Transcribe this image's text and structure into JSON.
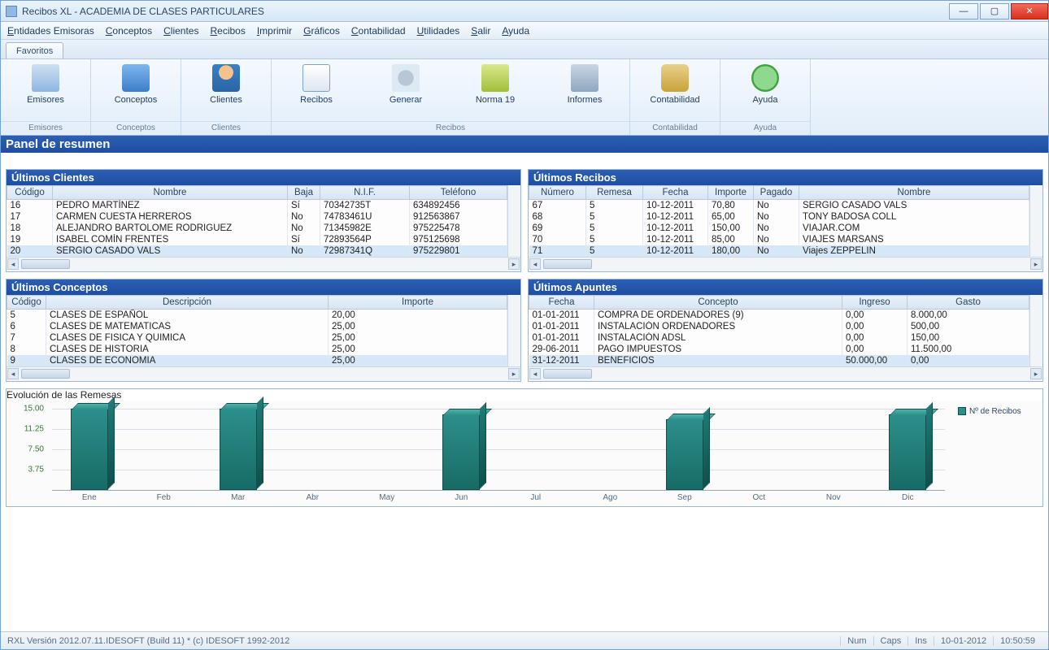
{
  "window": {
    "title": "Recibos XL - ACADEMIA DE CLASES PARTICULARES"
  },
  "menu": [
    "Entidades Emisoras",
    "Conceptos",
    "Clientes",
    "Recibos",
    "Imprimir",
    "Gráficos",
    "Contabilidad",
    "Utilidades",
    "Salir",
    "Ayuda"
  ],
  "ribbon": {
    "tab": "Favoritos",
    "groups": [
      {
        "caption": "Emisores",
        "items": [
          {
            "label": "Emisores",
            "icon": "building"
          }
        ]
      },
      {
        "caption": "Conceptos",
        "items": [
          {
            "label": "Conceptos",
            "icon": "box"
          }
        ]
      },
      {
        "caption": "Clientes",
        "items": [
          {
            "label": "Clientes",
            "icon": "person"
          }
        ]
      },
      {
        "caption": "Recibos",
        "items": [
          {
            "label": "Recibos",
            "icon": "edit"
          },
          {
            "label": "Generar",
            "icon": "gears"
          },
          {
            "label": "Norma 19",
            "icon": "money"
          },
          {
            "label": "Informes",
            "icon": "printer"
          }
        ]
      },
      {
        "caption": "Contabilidad",
        "items": [
          {
            "label": "Contabilidad",
            "icon": "bag"
          }
        ]
      },
      {
        "caption": "Ayuda",
        "items": [
          {
            "label": "Ayuda",
            "icon": "help"
          }
        ]
      }
    ]
  },
  "summary_title": "Panel de resumen",
  "panel_clientes": {
    "title": "Últimos Clientes",
    "cols": [
      "Código",
      "Nombre",
      "Baja",
      "N.I.F.",
      "Teléfono"
    ],
    "rows": [
      [
        "16",
        "PEDRO MARTÍNEZ",
        "Sí",
        "70342735T",
        "634892456"
      ],
      [
        "17",
        "CARMEN CUESTA HERREROS",
        "No",
        "74783461U",
        "912563867"
      ],
      [
        "18",
        "ALEJANDRO BARTOLOME RODRIGUEZ",
        "No",
        "71345982E",
        "975225478"
      ],
      [
        "19",
        "ISABEL COMÍN FRENTES",
        "Sí",
        "72893564P",
        "975125698"
      ],
      [
        "20",
        "SERGIO CASADO VALS",
        "No",
        "72987341Q",
        "975229801"
      ]
    ],
    "selected_index": 4
  },
  "panel_recibos": {
    "title": "Últimos Recibos",
    "cols": [
      "Número",
      "Remesa",
      "Fecha",
      "Importe",
      "Pagado",
      "Nombre"
    ],
    "rows": [
      [
        "67",
        "5",
        "10-12-2011",
        "70,80",
        "No",
        "SERGIO CASADO VALS"
      ],
      [
        "68",
        "5",
        "10-12-2011",
        "65,00",
        "No",
        "TONY BADOSA COLL"
      ],
      [
        "69",
        "5",
        "10-12-2011",
        "150,00",
        "No",
        "VIAJAR.COM"
      ],
      [
        "70",
        "5",
        "10-12-2011",
        "85,00",
        "No",
        "VIAJES MARSANS"
      ],
      [
        "71",
        "5",
        "10-12-2011",
        "180,00",
        "No",
        "Viajes ZEPPELIN"
      ]
    ],
    "selected_index": 4
  },
  "panel_conceptos": {
    "title": "Últimos Conceptos",
    "cols": [
      "Código",
      "Descripción",
      "Importe"
    ],
    "rows": [
      [
        "5",
        "CLASES DE ESPAÑOL",
        "20,00"
      ],
      [
        "6",
        "CLASES DE MATEMATICAS",
        "25,00"
      ],
      [
        "7",
        "CLASES DE FISICA Y QUIMICA",
        "25,00"
      ],
      [
        "8",
        "CLASES DE HISTORIA",
        "25,00"
      ],
      [
        "9",
        "CLASES DE ECONOMIA",
        "25,00"
      ]
    ],
    "selected_index": 4
  },
  "panel_apuntes": {
    "title": "Últimos Apuntes",
    "cols": [
      "Fecha",
      "Concepto",
      "Ingreso",
      "Gasto"
    ],
    "rows": [
      [
        "01-01-2011",
        "COMPRA DE ORDENADORES (9)",
        "0,00",
        "8.000,00"
      ],
      [
        "01-01-2011",
        "INSTALACIÓN ORDENADORES",
        "0,00",
        "500,00"
      ],
      [
        "01-01-2011",
        "INSTALACIÓN ADSL",
        "0,00",
        "150,00"
      ],
      [
        "29-06-2011",
        "PAGO IMPUESTOS",
        "0,00",
        "11.500,00"
      ],
      [
        "31-12-2011",
        "BENEFICIOS",
        "50.000,00",
        "0,00"
      ]
    ],
    "selected_index": 4
  },
  "chart_title": "Evolución de las Remesas",
  "chart_legend": "Nº de Recibos",
  "chart_data": {
    "type": "bar",
    "title": "Evolución de las Remesas",
    "xlabel": "",
    "ylabel": "",
    "ylim": [
      0,
      15
    ],
    "yticks": [
      3.75,
      7.5,
      11.25,
      15.0
    ],
    "categories": [
      "Ene",
      "Feb",
      "Mar",
      "Abr",
      "May",
      "Jun",
      "Jul",
      "Ago",
      "Sep",
      "Oct",
      "Nov",
      "Dic"
    ],
    "series": [
      {
        "name": "Nº de Recibos",
        "values": [
          16,
          0,
          16,
          0,
          0,
          14,
          0,
          0,
          13,
          0,
          0,
          14
        ]
      }
    ]
  },
  "status": {
    "left": "RXL Versión 2012.07.11.IDESOFT  (Build 11) * (c) IDESOFT 1992-2012",
    "cells": [
      "Num",
      "Caps",
      "Ins",
      "10-01-2012",
      "10:50:59"
    ]
  }
}
